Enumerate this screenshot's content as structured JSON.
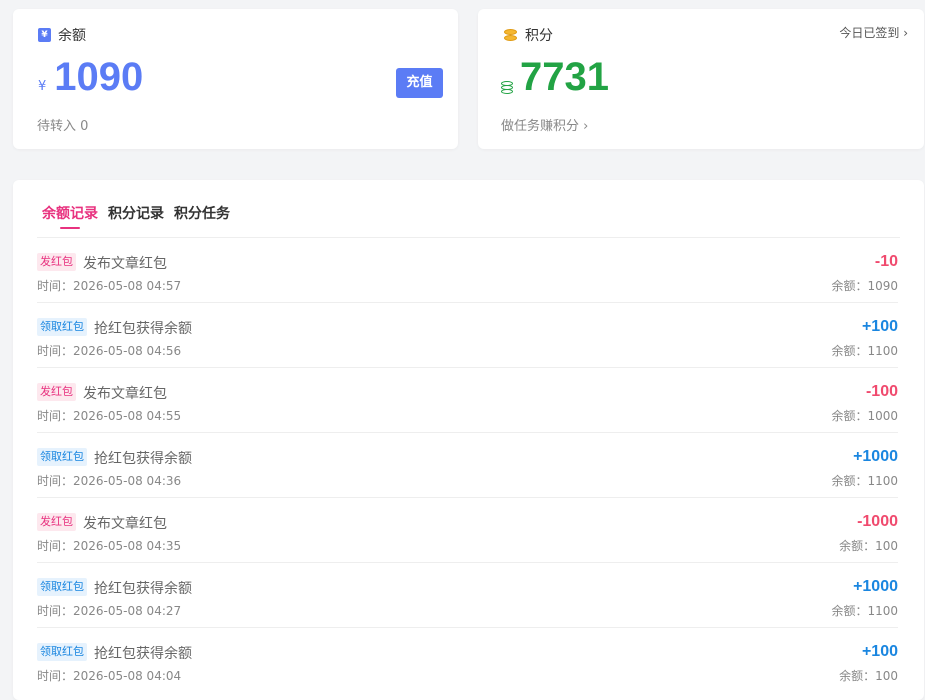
{
  "balance": {
    "label": "余额",
    "currency": "¥",
    "amount": "1090",
    "pending": "待转入 0",
    "recharge_label": "充值"
  },
  "points": {
    "label": "积分",
    "amount": "7731",
    "checkin": "今日已签到 ›",
    "tasks_link": "做任务赚积分 ›"
  },
  "tabs": [
    {
      "label": "余额记录",
      "active": true
    },
    {
      "label": "积分记录",
      "active": false
    },
    {
      "label": "积分任务",
      "active": false
    }
  ],
  "records": [
    {
      "tag": "发红包",
      "type": "send",
      "title": "发布文章红包",
      "time": "时间：2026-05-08 04:57",
      "amount": "-10",
      "balance": "余额：1090"
    },
    {
      "tag": "领取红包",
      "type": "recv",
      "title": "抢红包获得余额",
      "time": "时间：2026-05-08 04:56",
      "amount": "+100",
      "balance": "余额：1100"
    },
    {
      "tag": "发红包",
      "type": "send",
      "title": "发布文章红包",
      "time": "时间：2026-05-08 04:55",
      "amount": "-100",
      "balance": "余额：1000"
    },
    {
      "tag": "领取红包",
      "type": "recv",
      "title": "抢红包获得余额",
      "time": "时间：2026-05-08 04:36",
      "amount": "+1000",
      "balance": "余额：1100"
    },
    {
      "tag": "发红包",
      "type": "send",
      "title": "发布文章红包",
      "time": "时间：2026-05-08 04:35",
      "amount": "-1000",
      "balance": "余额：100"
    },
    {
      "tag": "领取红包",
      "type": "recv",
      "title": "抢红包获得余额",
      "time": "时间：2026-05-08 04:27",
      "amount": "+1000",
      "balance": "余额：1100"
    },
    {
      "tag": "领取红包",
      "type": "recv",
      "title": "抢红包获得余额",
      "time": "时间：2026-05-08 04:04",
      "amount": "+100",
      "balance": "余额：100"
    }
  ]
}
